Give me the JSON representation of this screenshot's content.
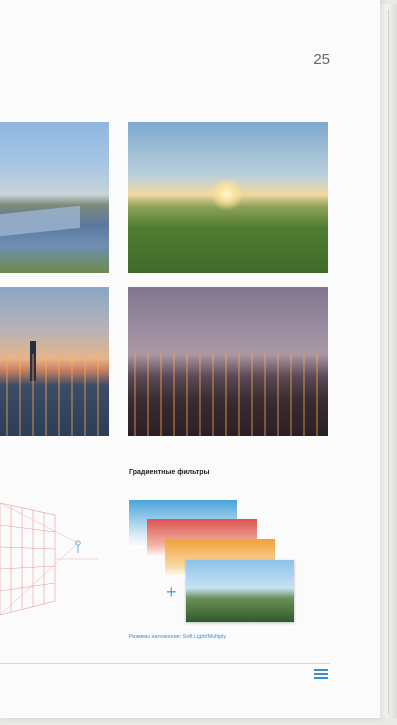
{
  "page": {
    "number": "25"
  },
  "section": {
    "title": "Градиентные фильтры",
    "caption": "Режимы наложения: Soft Light/Multiply"
  },
  "colors": {
    "accent": "#3a8ed0",
    "filter_blue": "#4aa3dc",
    "filter_red": "#d9534f",
    "filter_orange": "#f0a23a"
  },
  "icons": {
    "menu": "menu-icon",
    "plus": "plus-icon"
  }
}
